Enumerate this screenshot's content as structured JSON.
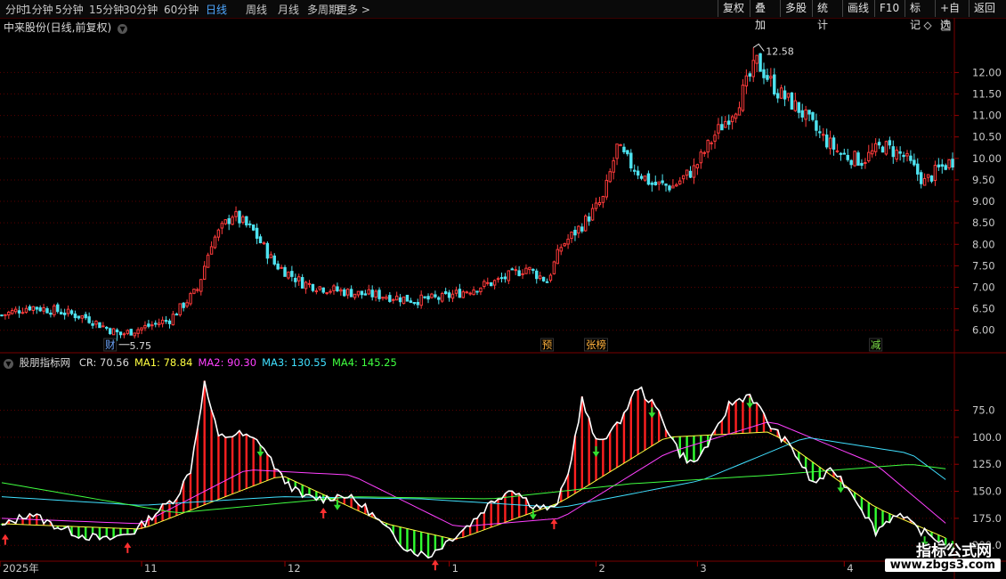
{
  "toolbar": {
    "periods": [
      "分时",
      "1分钟",
      "5分钟",
      "15分钟",
      "30分钟",
      "60分钟",
      "日线",
      "周线",
      "月线",
      "多周期",
      "更多 >"
    ],
    "active_period": "日线",
    "right_buttons": [
      "复权",
      "叠加",
      "多股",
      "统计",
      "画线",
      "F10",
      "标记",
      "+自选",
      "返回"
    ]
  },
  "stock": {
    "title": "中来股份(日线,前复权)"
  },
  "price_chart": {
    "y_ticks": [
      "12.00",
      "11.50",
      "11.00",
      "10.50",
      "10.00",
      "9.50",
      "9.00",
      "8.50",
      "8.00",
      "7.50",
      "7.00",
      "6.50",
      "6.00"
    ],
    "high_marker": "12.58",
    "low_marker": "5.75",
    "event_tags": [
      {
        "text": "财",
        "color": "#6fa8ff",
        "day": 31
      },
      {
        "text": "预",
        "color": "#ffb13d",
        "day": 156
      },
      {
        "text": "张榜",
        "color": "#ffb13d",
        "day": 170
      },
      {
        "text": "减",
        "color": "#7ee04a",
        "day": 250
      }
    ],
    "colors": {
      "up": "#ff3b3b",
      "down": "#4ee3f0"
    }
  },
  "indicator": {
    "name": "股朋指标网",
    "values": [
      {
        "label": "CR: 70.56",
        "color": "#dcdcdc"
      },
      {
        "label": "MA1: 78.84",
        "color": "#ffff40"
      },
      {
        "label": "MA2: 90.30",
        "color": "#ff40ff"
      },
      {
        "label": "MA3: 130.55",
        "color": "#40e0ff"
      },
      {
        "label": "MA4: 145.25",
        "color": "#40ff40"
      }
    ],
    "y_ticks": [
      "200.0",
      "175.0",
      "150.0",
      "125.0",
      "100.0",
      "75.0"
    ]
  },
  "time_axis": {
    "labels": [
      "2025年",
      "11",
      "12",
      "1",
      "2",
      "3",
      "4"
    ]
  },
  "watermark": {
    "title": "指标公式网",
    "url": "www.zbgs3.com"
  },
  "chart_data": [
    {
      "type": "candlestick",
      "title": "中来股份(日线,前复权)",
      "ylim": [
        5.6,
        12.9
      ],
      "y_ticks": [
        6.0,
        6.5,
        7.0,
        7.5,
        8.0,
        8.5,
        9.0,
        9.5,
        10.0,
        10.5,
        11.0,
        11.5,
        12.0
      ],
      "close_path": [
        [
          0,
          6.35
        ],
        [
          8,
          6.55
        ],
        [
          16,
          6.45
        ],
        [
          24,
          6.3
        ],
        [
          30,
          6.05
        ],
        [
          34,
          5.9
        ],
        [
          40,
          6.05
        ],
        [
          48,
          6.25
        ],
        [
          56,
          6.95
        ],
        [
          60,
          8.05
        ],
        [
          66,
          8.7
        ],
        [
          72,
          8.3
        ],
        [
          78,
          7.55
        ],
        [
          86,
          7.1
        ],
        [
          94,
          6.95
        ],
        [
          102,
          6.85
        ],
        [
          110,
          6.8
        ],
        [
          118,
          6.7
        ],
        [
          126,
          6.75
        ],
        [
          134,
          6.95
        ],
        [
          142,
          7.15
        ],
        [
          150,
          7.45
        ],
        [
          156,
          7.15
        ],
        [
          160,
          7.95
        ],
        [
          166,
          8.45
        ],
        [
          172,
          9.05
        ],
        [
          176,
          10.25
        ],
        [
          180,
          9.85
        ],
        [
          186,
          9.4
        ],
        [
          192,
          9.35
        ],
        [
          198,
          9.75
        ],
        [
          204,
          10.55
        ],
        [
          210,
          11.2
        ],
        [
          216,
          12.25
        ],
        [
          222,
          11.55
        ],
        [
          228,
          11.15
        ],
        [
          234,
          10.55
        ],
        [
          240,
          10.1
        ],
        [
          246,
          9.95
        ],
        [
          252,
          10.3
        ],
        [
          258,
          10.05
        ],
        [
          264,
          9.45
        ],
        [
          268,
          9.75
        ],
        [
          272,
          9.95
        ]
      ],
      "high": 12.58,
      "low": 5.75
    },
    {
      "type": "line",
      "title": "股朋指标网",
      "ylim": [
        62,
        240
      ],
      "y_ticks": [
        75,
        100,
        125,
        150,
        175,
        200
      ],
      "cr_path": [
        [
          0,
          92
        ],
        [
          8,
          105
        ],
        [
          14,
          95
        ],
        [
          22,
          85
        ],
        [
          30,
          80
        ],
        [
          38,
          88
        ],
        [
          44,
          105
        ],
        [
          50,
          120
        ],
        [
          54,
          145
        ],
        [
          58,
          225
        ],
        [
          62,
          175
        ],
        [
          68,
          178
        ],
        [
          74,
          170
        ],
        [
          80,
          138
        ],
        [
          86,
          120
        ],
        [
          92,
          118
        ],
        [
          98,
          122
        ],
        [
          104,
          110
        ],
        [
          110,
          90
        ],
        [
          116,
          72
        ],
        [
          122,
          65
        ],
        [
          128,
          80
        ],
        [
          134,
          95
        ],
        [
          140,
          115
        ],
        [
          146,
          128
        ],
        [
          152,
          112
        ],
        [
          158,
          108
        ],
        [
          162,
          140
        ],
        [
          166,
          210
        ],
        [
          170,
          170
        ],
        [
          176,
          185
        ],
        [
          182,
          222
        ],
        [
          188,
          198
        ],
        [
          194,
          160
        ],
        [
          198,
          150
        ],
        [
          204,
          178
        ],
        [
          208,
          205
        ],
        [
          214,
          215
        ],
        [
          220,
          185
        ],
        [
          226,
          165
        ],
        [
          232,
          132
        ],
        [
          238,
          145
        ],
        [
          244,
          120
        ],
        [
          250,
          88
        ],
        [
          256,
          105
        ],
        [
          262,
          90
        ],
        [
          268,
          80
        ],
        [
          272,
          72
        ]
      ],
      "series": [
        {
          "name": "MA1",
          "last": 78.84,
          "path": [
            [
              0,
              95
            ],
            [
              40,
              90
            ],
            [
              80,
              140
            ],
            [
              110,
              95
            ],
            [
              130,
              80
            ],
            [
              160,
              115
            ],
            [
              190,
              175
            ],
            [
              220,
              180
            ],
            [
              250,
              110
            ],
            [
              272,
              79
            ]
          ]
        },
        {
          "name": "MA2",
          "last": 90.3,
          "path": [
            [
              0,
              100
            ],
            [
              40,
              95
            ],
            [
              70,
              145
            ],
            [
              100,
              140
            ],
            [
              130,
              92
            ],
            [
              160,
              100
            ],
            [
              190,
              160
            ],
            [
              220,
              190
            ],
            [
              250,
              150
            ],
            [
              272,
              90
            ]
          ]
        },
        {
          "name": "MA3",
          "last": 130.55,
          "path": [
            [
              0,
              120
            ],
            [
              40,
              112
            ],
            [
              80,
              120
            ],
            [
              120,
              118
            ],
            [
              160,
              110
            ],
            [
              200,
              135
            ],
            [
              230,
              175
            ],
            [
              260,
              160
            ],
            [
              272,
              131
            ]
          ]
        },
        {
          "name": "MA4",
          "last": 145.25,
          "path": [
            [
              0,
              133
            ],
            [
              50,
              105
            ],
            [
              100,
              120
            ],
            [
              140,
              118
            ],
            [
              180,
              132
            ],
            [
              220,
              140
            ],
            [
              260,
              150
            ],
            [
              272,
              145
            ]
          ]
        }
      ],
      "buy_days": [
        1,
        36,
        92,
        124,
        158
      ],
      "sell_days": [
        74,
        96,
        152,
        170,
        186,
        214,
        240,
        264
      ]
    }
  ]
}
